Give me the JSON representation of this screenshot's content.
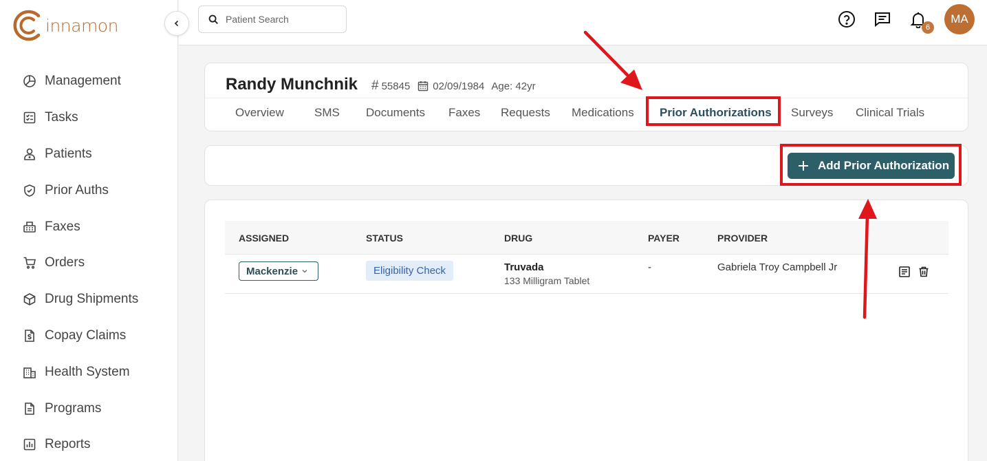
{
  "brand": {
    "name": "innamon",
    "accent": "#b86a2e"
  },
  "sidebar": {
    "items": [
      {
        "label": "Management",
        "icon": "chart-pie-icon"
      },
      {
        "label": "Tasks",
        "icon": "checklist-icon"
      },
      {
        "label": "Patients",
        "icon": "patient-icon"
      },
      {
        "label": "Prior Auths",
        "icon": "shield-check-icon"
      },
      {
        "label": "Faxes",
        "icon": "fax-icon"
      },
      {
        "label": "Orders",
        "icon": "cart-icon"
      },
      {
        "label": "Drug Shipments",
        "icon": "box-icon"
      },
      {
        "label": "Copay Claims",
        "icon": "dollar-doc-icon"
      },
      {
        "label": "Health System",
        "icon": "building-icon"
      },
      {
        "label": "Programs",
        "icon": "document-icon"
      },
      {
        "label": "Reports",
        "icon": "report-icon"
      }
    ]
  },
  "topbar": {
    "search_placeholder": "Patient Search",
    "notification_count": "6",
    "avatar_initials": "MA"
  },
  "patient": {
    "name": "Randy Munchnik",
    "hash": "#",
    "id": "55845",
    "dob": "02/09/1984",
    "age": "Age: 42yr"
  },
  "tabs": [
    {
      "label": "Overview"
    },
    {
      "label": "SMS"
    },
    {
      "label": "Documents"
    },
    {
      "label": "Faxes"
    },
    {
      "label": "Requests"
    },
    {
      "label": "Medications"
    },
    {
      "label": "Prior Authorizations",
      "active": true
    },
    {
      "label": "Surveys"
    },
    {
      "label": "Clinical Trials"
    }
  ],
  "actions": {
    "add_label": "Add Prior Authorization"
  },
  "table": {
    "headers": [
      "ASSIGNED",
      "STATUS",
      "DRUG",
      "PAYER",
      "PROVIDER"
    ],
    "rows": [
      {
        "assigned": "Mackenzie",
        "status": "Eligibility Check",
        "drug": "Truvada",
        "drug_detail": "133 Milligram Tablet",
        "payer": "-",
        "provider": "Gabriela Troy Campbell Jr"
      }
    ]
  },
  "colors": {
    "primary": "#2d5f69",
    "highlight": "#e0161d",
    "status_chip_bg": "#e3ecf9",
    "status_chip_text": "#3565a8"
  }
}
